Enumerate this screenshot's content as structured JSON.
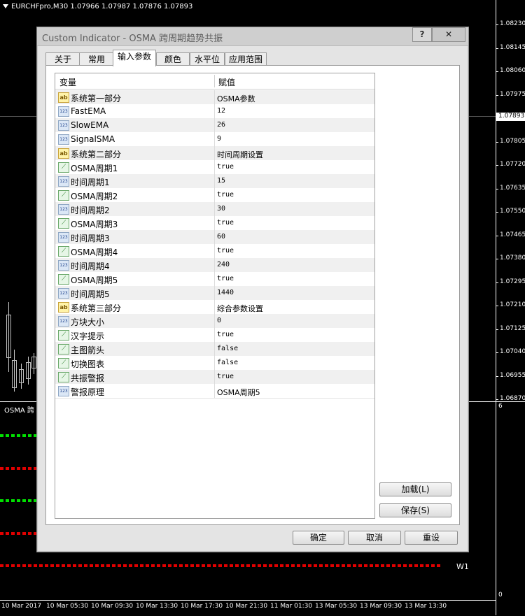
{
  "chart": {
    "symbol_title": "EURCHFpro,M30  1.07966 1.07987 1.07876 1.07893",
    "current_price": "1.07893",
    "price_ticks": [
      "1.08230",
      "1.08145",
      "1.08060",
      "1.07975",
      "1.07893",
      "1.07805",
      "1.07720",
      "1.07635",
      "1.07550",
      "1.07465",
      "1.07380",
      "1.07295",
      "1.07210",
      "1.07125",
      "1.07040",
      "1.06955",
      "1.06870"
    ],
    "subwindow_label": "OSMA 跨",
    "subwindow_max": "6",
    "subwindow_zero": "0",
    "w1_label": "W1",
    "time_ticks": [
      "10 Mar 2017",
      "10 Mar 05:30",
      "10 Mar 09:30",
      "10 Mar 13:30",
      "10 Mar 17:30",
      "10 Mar 21:30",
      "11 Mar 01:30",
      "13 Mar 05:30",
      "13 Mar 09:30",
      "13 Mar 13:30"
    ],
    "colors": {
      "green_dots": "#00e000",
      "red_dots": "#e00000",
      "background": "#000000"
    }
  },
  "dialog": {
    "title": "Custom Indicator - OSMA 跨周期趋势共振",
    "help_label": "?",
    "close_label": "✕",
    "tabs": [
      "关于",
      "常用",
      "输入参数",
      "颜色",
      "水平位",
      "应用范围"
    ],
    "active_tab": "输入参数",
    "grid": {
      "col_variable": "变量",
      "col_value": "赋值",
      "rows": [
        {
          "icon": "ab",
          "name": "系统第一部分",
          "value": "OSMA参数"
        },
        {
          "icon": "123",
          "name": "FastEMA",
          "value": "12"
        },
        {
          "icon": "123",
          "name": "SlowEMA",
          "value": "26"
        },
        {
          "icon": "123",
          "name": "SignalSMA",
          "value": "9"
        },
        {
          "icon": "ab",
          "name": "系统第二部分",
          "value": "时间周期设置"
        },
        {
          "icon": "bool",
          "name": "OSMA周期1",
          "value": "true"
        },
        {
          "icon": "123",
          "name": "时间周期1",
          "value": "15"
        },
        {
          "icon": "bool",
          "name": "OSMA周期2",
          "value": "true"
        },
        {
          "icon": "123",
          "name": "时间周期2",
          "value": "30"
        },
        {
          "icon": "bool",
          "name": "OSMA周期3",
          "value": "true"
        },
        {
          "icon": "123",
          "name": "时间周期3",
          "value": "60"
        },
        {
          "icon": "bool",
          "name": "OSMA周期4",
          "value": "true"
        },
        {
          "icon": "123",
          "name": "时间周期4",
          "value": "240"
        },
        {
          "icon": "bool",
          "name": "OSMA周期5",
          "value": "true"
        },
        {
          "icon": "123",
          "name": "时间周期5",
          "value": "1440"
        },
        {
          "icon": "ab",
          "name": "系统第三部分",
          "value": "综合参数设置"
        },
        {
          "icon": "123",
          "name": "方块大小",
          "value": "0"
        },
        {
          "icon": "bool",
          "name": "汉字提示",
          "value": "true"
        },
        {
          "icon": "bool",
          "name": "主图箭头",
          "value": "false"
        },
        {
          "icon": "bool",
          "name": "切换图表",
          "value": "false"
        },
        {
          "icon": "bool",
          "name": "共振警报",
          "value": "true"
        },
        {
          "icon": "123",
          "name": "警报原理",
          "value": "OSMA周期5"
        }
      ]
    },
    "buttons": {
      "load": "加载(L)",
      "save": "保存(S)",
      "ok": "确定",
      "cancel": "取消",
      "reset": "重设"
    }
  }
}
